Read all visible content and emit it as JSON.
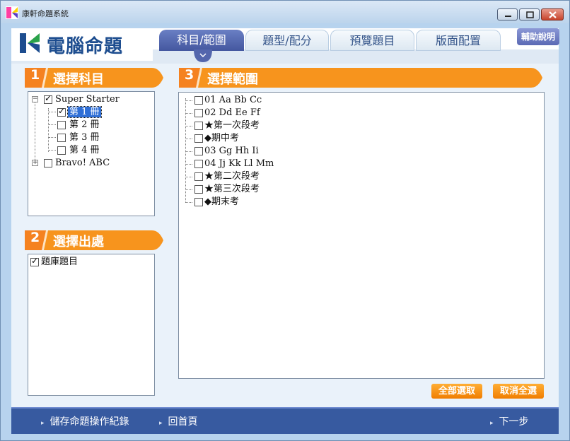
{
  "window": {
    "title": "康軒命題系統"
  },
  "logo": {
    "text": "電腦命題"
  },
  "tabs": [
    {
      "label": "科目/範圍",
      "active": true
    },
    {
      "label": "題型/配分",
      "active": false
    },
    {
      "label": "預覽題目",
      "active": false
    },
    {
      "label": "版面配置",
      "active": false
    }
  ],
  "help_button": "輔助說明",
  "sections": {
    "subject": {
      "num": "1",
      "label": "選擇科目"
    },
    "source": {
      "num": "2",
      "label": "選擇出處"
    },
    "scope": {
      "num": "3",
      "label": "選擇範圍"
    }
  },
  "subject_tree": {
    "root1": {
      "label": "Super Starter",
      "checked": true,
      "expanded": true
    },
    "children": [
      {
        "label": "第 1 冊",
        "checked": true,
        "selected": true
      },
      {
        "label": "第 2 冊",
        "checked": false
      },
      {
        "label": "第 3 冊",
        "checked": false
      },
      {
        "label": "第 4 冊",
        "checked": false
      }
    ],
    "root2": {
      "label": "Bravo! ABC",
      "checked": false,
      "expanded": false
    }
  },
  "source_items": [
    {
      "label": "題庫題目",
      "checked": true
    }
  ],
  "scope_items": [
    {
      "label": "01 Aa  Bb  Cc",
      "checked": false
    },
    {
      "label": "02 Dd  Ee  Ff",
      "checked": false
    },
    {
      "label": "★第一次段考",
      "checked": false
    },
    {
      "label": "◆期中考",
      "checked": false
    },
    {
      "label": "03 Gg  Hh  Ii",
      "checked": false
    },
    {
      "label": "04 Jj  Kk  Ll  Mm",
      "checked": false
    },
    {
      "label": "★第二次段考",
      "checked": false
    },
    {
      "label": "★第三次段考",
      "checked": false
    },
    {
      "label": "◆期末考",
      "checked": false
    }
  ],
  "buttons": {
    "select_all": "全部選取",
    "deselect_all": "取消全選"
  },
  "footer": {
    "save_log": "儲存命題操作紀錄",
    "home": "回首頁",
    "next": "下一步"
  },
  "colors": {
    "accent_orange": "#f7941d",
    "nav_blue": "#375aa0",
    "tab_active": "#4f63ab",
    "brand_blue": "#1d4d8f"
  }
}
